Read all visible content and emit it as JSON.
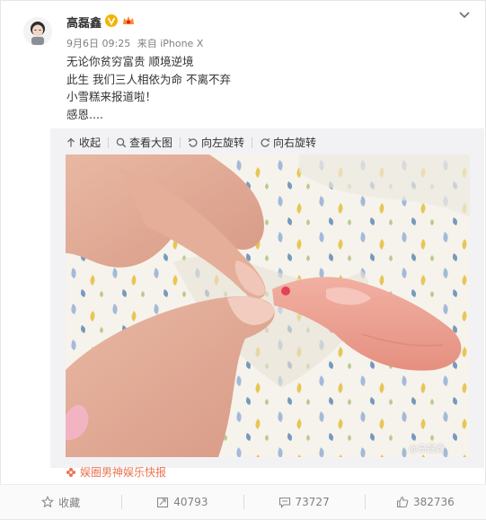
{
  "post": {
    "author": "高磊鑫",
    "time": "9月6日 09:25",
    "source_via": "来自 iPhone X",
    "lines": [
      "无论你贫穷富贵 顺境逆境",
      "此生 我们三人相依为命 不离不弃",
      "小雪糕来报道啦！",
      "感恩...."
    ]
  },
  "media_toolbar": {
    "collapse": "收起",
    "view_large": "查看大图",
    "rotate_left": "向左旋转",
    "rotate_right": "向右旋转"
  },
  "photo": {
    "watermark": "@高磊鑫"
  },
  "footer_source": {
    "label": "娱圈男神娱乐快报"
  },
  "actions": {
    "favorite": "收藏",
    "repost": "40793",
    "comment": "73727",
    "like": "382736"
  },
  "colors": {
    "source_link": "#eb7350",
    "badge": "#f5b300"
  }
}
